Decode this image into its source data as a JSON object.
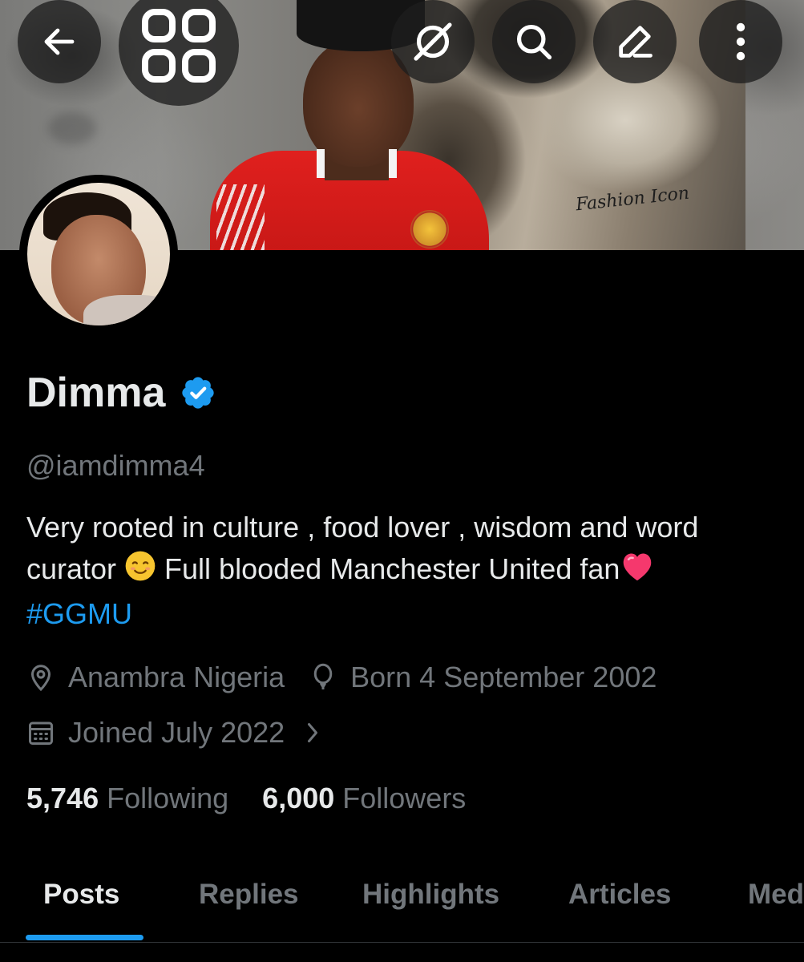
{
  "header": {
    "back_icon": "arrow-left-icon",
    "grid_icon": "grid-apps-icon",
    "actions": [
      {
        "icon": "grok-slash-icon"
      },
      {
        "icon": "search-icon"
      },
      {
        "icon": "edit-pencil-icon"
      },
      {
        "icon": "more-vertical-icon"
      }
    ]
  },
  "banner": {
    "watermark_text": "Fashion Icon"
  },
  "profile": {
    "display_name": "Dimma",
    "verified": true,
    "handle": "@iamdimma4",
    "bio_line1": "Very rooted in culture , food lover , wisdom and word",
    "bio_line2": "curator ",
    "bio_line2b": " Full blooded Manchester United fan",
    "hashtag": "#GGMU",
    "location": "Anambra Nigeria",
    "birthday": "Born 4 September 2002",
    "joined": "Joined July 2022",
    "following_count": "5,746",
    "following_label": "Following",
    "followers_count": "6,000",
    "followers_label": "Followers"
  },
  "tabs": [
    {
      "label": "Posts",
      "active": true
    },
    {
      "label": "Replies",
      "active": false
    },
    {
      "label": "Highlights",
      "active": false
    },
    {
      "label": "Articles",
      "active": false
    },
    {
      "label": "Media",
      "active": false
    }
  ],
  "colors": {
    "background": "#000000",
    "primary_text": "#e7e9ea",
    "secondary_text": "#71767b",
    "accent": "#1d9bf0",
    "verified": "#1d9bf0"
  }
}
